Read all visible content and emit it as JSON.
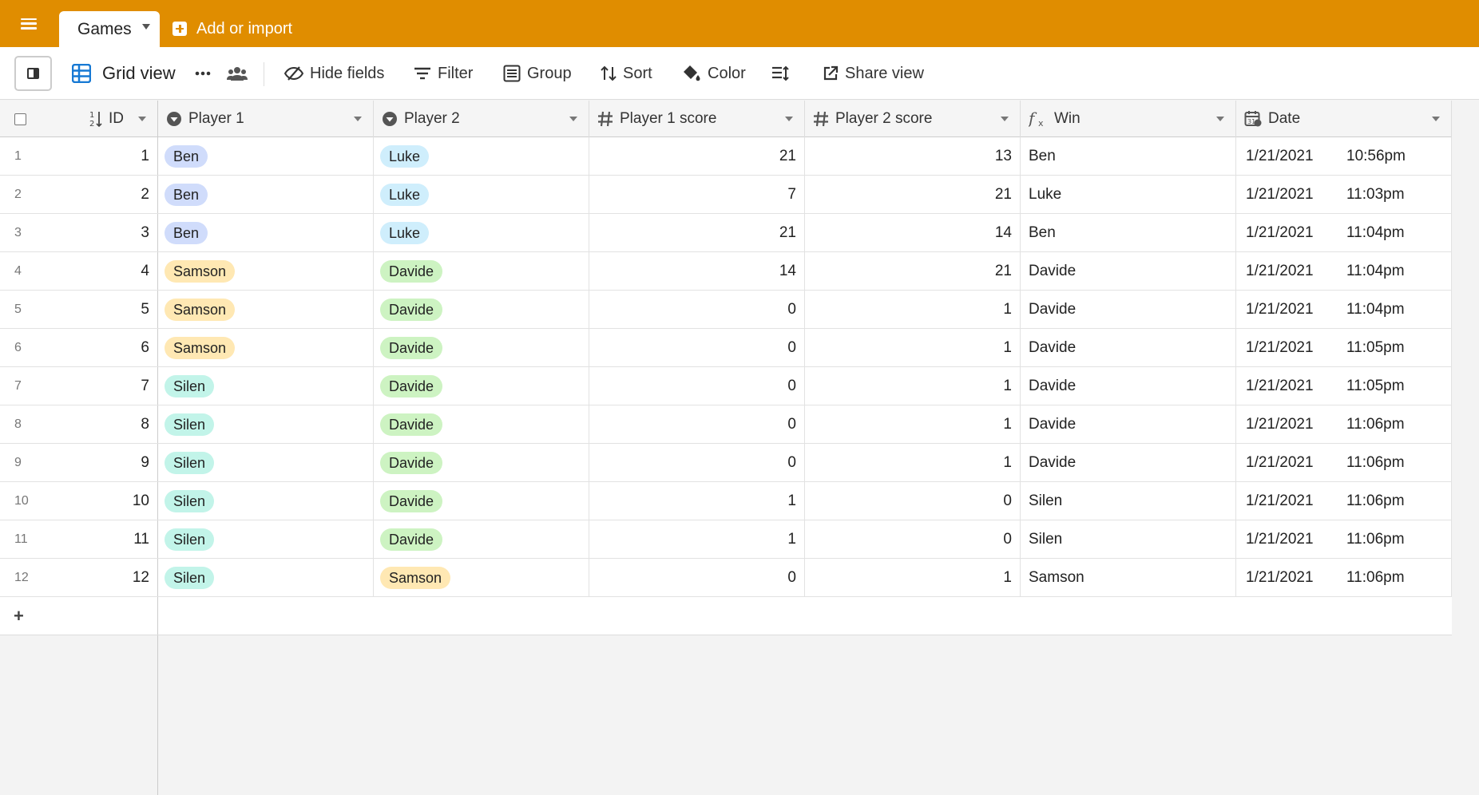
{
  "topbar": {
    "table_tab": "Games",
    "add_import": "Add or import"
  },
  "toolbar": {
    "view_name": "Grid view",
    "hide_fields": "Hide fields",
    "filter": "Filter",
    "group": "Group",
    "sort": "Sort",
    "color": "Color",
    "share_view": "Share view"
  },
  "columns": {
    "id": "ID",
    "player1": "Player 1",
    "player2": "Player 2",
    "player1_score": "Player 1 score",
    "player2_score": "Player 2 score",
    "win": "Win",
    "date": "Date"
  },
  "pill_colors": {
    "Ben": "#d0dcfb",
    "Luke": "#cfeefc",
    "Samson": "#ffe8b3",
    "Davide": "#cdf3c2",
    "Silen": "#c2f4e9"
  },
  "rows": [
    {
      "num": "1",
      "id": "1",
      "p1": "Ben",
      "p2": "Luke",
      "s1": "21",
      "s2": "13",
      "win": "Ben",
      "date": "1/21/2021",
      "time": "10:56pm"
    },
    {
      "num": "2",
      "id": "2",
      "p1": "Ben",
      "p2": "Luke",
      "s1": "7",
      "s2": "21",
      "win": "Luke",
      "date": "1/21/2021",
      "time": "11:03pm"
    },
    {
      "num": "3",
      "id": "3",
      "p1": "Ben",
      "p2": "Luke",
      "s1": "21",
      "s2": "14",
      "win": "Ben",
      "date": "1/21/2021",
      "time": "11:04pm"
    },
    {
      "num": "4",
      "id": "4",
      "p1": "Samson",
      "p2": "Davide",
      "s1": "14",
      "s2": "21",
      "win": "Davide",
      "date": "1/21/2021",
      "time": "11:04pm"
    },
    {
      "num": "5",
      "id": "5",
      "p1": "Samson",
      "p2": "Davide",
      "s1": "0",
      "s2": "1",
      "win": "Davide",
      "date": "1/21/2021",
      "time": "11:04pm"
    },
    {
      "num": "6",
      "id": "6",
      "p1": "Samson",
      "p2": "Davide",
      "s1": "0",
      "s2": "1",
      "win": "Davide",
      "date": "1/21/2021",
      "time": "11:05pm"
    },
    {
      "num": "7",
      "id": "7",
      "p1": "Silen",
      "p2": "Davide",
      "s1": "0",
      "s2": "1",
      "win": "Davide",
      "date": "1/21/2021",
      "time": "11:05pm"
    },
    {
      "num": "8",
      "id": "8",
      "p1": "Silen",
      "p2": "Davide",
      "s1": "0",
      "s2": "1",
      "win": "Davide",
      "date": "1/21/2021",
      "time": "11:06pm"
    },
    {
      "num": "9",
      "id": "9",
      "p1": "Silen",
      "p2": "Davide",
      "s1": "0",
      "s2": "1",
      "win": "Davide",
      "date": "1/21/2021",
      "time": "11:06pm"
    },
    {
      "num": "10",
      "id": "10",
      "p1": "Silen",
      "p2": "Davide",
      "s1": "1",
      "s2": "0",
      "win": "Silen",
      "date": "1/21/2021",
      "time": "11:06pm"
    },
    {
      "num": "11",
      "id": "11",
      "p1": "Silen",
      "p2": "Davide",
      "s1": "1",
      "s2": "0",
      "win": "Silen",
      "date": "1/21/2021",
      "time": "11:06pm"
    },
    {
      "num": "12",
      "id": "12",
      "p1": "Silen",
      "p2": "Samson",
      "s1": "0",
      "s2": "1",
      "win": "Samson",
      "date": "1/21/2021",
      "time": "11:06pm"
    }
  ]
}
